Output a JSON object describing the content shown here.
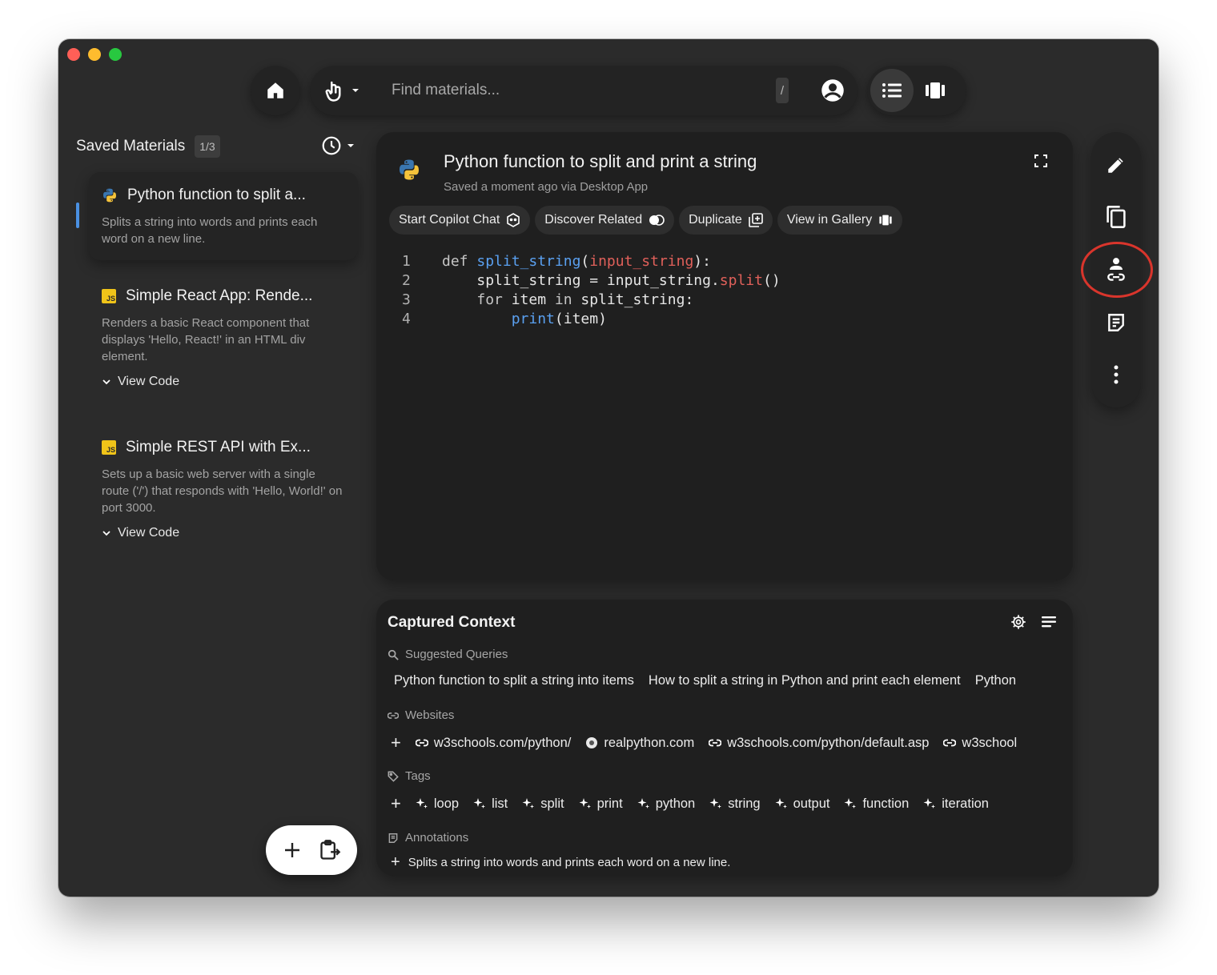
{
  "search": {
    "placeholder": "Find materials...",
    "shortcut": "/"
  },
  "sidebar": {
    "title": "Saved Materials",
    "count": "1/3",
    "items": [
      {
        "title": "Python function to split a...",
        "description": "Splits a string into words and prints each word on a new line.",
        "lang": "python"
      },
      {
        "title": "Simple React App: Rende...",
        "description": "Renders a basic React component that displays 'Hello, React!' in an HTML div element.",
        "lang": "JS",
        "toggle": "View Code"
      },
      {
        "title": "Simple REST API with Ex...",
        "description": "Sets up a basic web server with a single route ('/') that responds with 'Hello, World!' on port 3000.",
        "lang": "JS",
        "toggle": "View Code"
      }
    ]
  },
  "material": {
    "title": "Python function to split and print a string",
    "subtitle": "Saved a moment ago via Desktop App",
    "actions": [
      "Start Copilot Chat",
      "Discover Related",
      "Duplicate",
      "View in Gallery"
    ]
  },
  "code": {
    "line_numbers": [
      "1",
      "2",
      "3",
      "4"
    ],
    "l1": {
      "kw": "def ",
      "fn": "split_string",
      "open": "(",
      "param": "input_string",
      "close": "):"
    },
    "l2": {
      "indent": "    ",
      "lhs": "split_string = input_string.",
      "method": "split",
      "call": "()"
    },
    "l3": {
      "indent": "    ",
      "kw": "for ",
      "rest": "item ",
      "kw2": "in ",
      "rest2": "split_string:"
    },
    "l4": {
      "indent": "        ",
      "fn": "print",
      "args": "(item)"
    }
  },
  "context": {
    "title": "Captured Context",
    "suggested_label": "Suggested Queries",
    "queries": [
      "Python function to split a string into items",
      "How to split a string in Python and print each element",
      "Python"
    ],
    "websites_label": "Websites",
    "websites": [
      "w3schools.com/python/",
      "realpython.com",
      "w3schools.com/python/default.asp",
      "w3school"
    ],
    "tags_label": "Tags",
    "tags": [
      "loop",
      "list",
      "split",
      "print",
      "python",
      "string",
      "output",
      "function",
      "iteration"
    ],
    "annotations_label": "Annotations",
    "annotation": "Splits a string into words and prints each word on a new line."
  },
  "colors": {
    "accent_blue": "#4a90e2",
    "highlight_red": "#d9352c",
    "code_fn": "#5aa0f0",
    "code_param": "#e0605a"
  }
}
